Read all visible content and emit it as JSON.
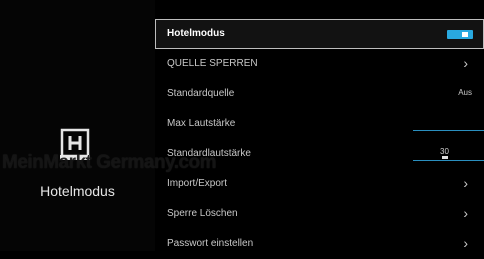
{
  "left_panel": {
    "title": "Hotelmodus",
    "icon": "hotel-h-icon",
    "watermark": "MeinMarkt Germany.com"
  },
  "menu": {
    "items": [
      {
        "label": "Hotelmodus",
        "control": "toggle",
        "state": "on"
      },
      {
        "label": "QUELLE SPERREN",
        "control": "chevron"
      },
      {
        "label": "Standardquelle",
        "control": "value",
        "value": "Aus"
      },
      {
        "label": "Max Lautstärke",
        "control": "slider"
      },
      {
        "label": "Standardlautstärke",
        "control": "slider",
        "value": "30"
      },
      {
        "label": "Import/Export",
        "control": "chevron"
      },
      {
        "label": "Sperre Löschen",
        "control": "chevron"
      },
      {
        "label": "Passwort einstellen",
        "control": "chevron"
      }
    ]
  },
  "colors": {
    "accent": "#29a9e0",
    "background": "#000000",
    "text": "#c8c8c8"
  }
}
